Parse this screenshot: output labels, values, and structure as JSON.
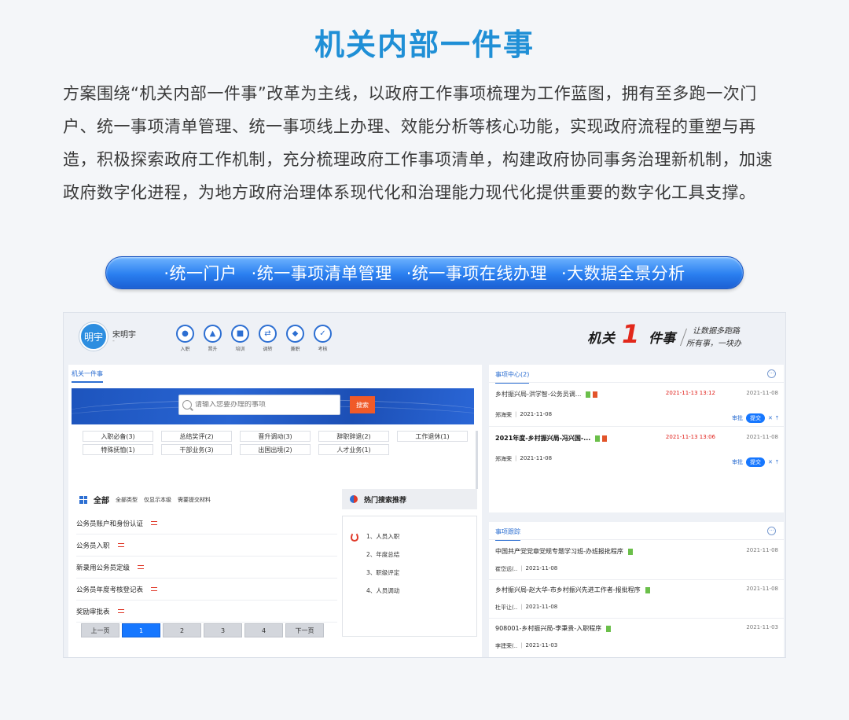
{
  "hero": {
    "title": "机关内部一件事",
    "description": "方案围绕“机关内部一件事”改革为主线，以政府工作事项梳理为工作蓝图，拥有至多跑一次门户、统一事项清单管理、统一事项线上办理、效能分析等核心功能，实现政府流程的重塑与再造，积极探索政府工作机制，充分梳理政府工作事项清单，构建政府协同事务治理新机制，加速政府数字化进程，为地方政府治理体系现代化和治理能力现代化提供重要的数字化工具支撑。",
    "features": [
      "·统一门户",
      "·统一事项清单管理",
      "·统一事项在线办理",
      "·大数据全景分析"
    ]
  },
  "app": {
    "user": {
      "avatar_text": "明宇",
      "name": "宋明宇",
      "sub": "-"
    },
    "quick_actions": [
      {
        "label": "入职",
        "icon": "onboard-icon"
      },
      {
        "label": "晋升",
        "icon": "promotion-icon"
      },
      {
        "label": "培训",
        "icon": "training-icon"
      },
      {
        "label": "调转",
        "icon": "transfer-icon"
      },
      {
        "label": "兼职",
        "icon": "part-time-icon"
      },
      {
        "label": "考核",
        "icon": "assessment-icon"
      }
    ],
    "logo": {
      "part1": "机关",
      "one": "1",
      "part2": "件事",
      "slogan1": "让数据多跑路",
      "slogan2": "所有事，一块办"
    },
    "left": {
      "title": "机关一件事",
      "search_placeholder": "请输入您要办理的事项",
      "search_button": "搜索",
      "categories": [
        "入职必备(3)",
        "总结奖评(2)",
        "晋升调动(3)",
        "辞职辞退(2)",
        "工作退休(1)",
        "特殊抚恤(1)",
        "干部业务(3)",
        "出国出境(2)",
        "人才业务(1)"
      ],
      "filter": {
        "all": "全部",
        "options": [
          "全部类型",
          "仅显示本级",
          "需要提交材料"
        ]
      },
      "items": [
        "公务员账户和身份认证",
        "公务员入职",
        "新录用公务员定级",
        "公务员年度考核登记表",
        "奖励审批表"
      ],
      "pager": [
        "上一页",
        "1",
        "2",
        "3",
        "4",
        "下一页"
      ],
      "pager_active": "1",
      "hot": {
        "title": "热门搜索推荐",
        "items": [
          "1、人员入职",
          "2、年度总结",
          "3、职级评定",
          "4、人员调动"
        ]
      }
    },
    "events": {
      "title": "事项中心(2)",
      "more": "···",
      "items": [
        {
          "title": "乡村振兴局-洪学智-公务员调...",
          "bold": false,
          "time": "2021-11-13 13:12",
          "date": "2021-11-08",
          "person": "郑海荣",
          "person_date": "2021-11-08",
          "approve": "审批",
          "submit": "提交",
          "close": "✕",
          "pin": "⤒"
        },
        {
          "title": "2021年度-乡村振兴局-冯兴国-...",
          "bold": true,
          "time": "2021-11-13 13:06",
          "date": "2021-11-08",
          "person": "郑海荣",
          "person_date": "2021-11-08",
          "approve": "审批",
          "submit": "提交",
          "close": "✕",
          "pin": "⤒"
        }
      ]
    },
    "tracking": {
      "title": "事项跟踪",
      "more": "···",
      "items": [
        {
          "title": "中国共产党党章党规专题学习班-办班报批程序",
          "date": "2021-11-08",
          "person": "崔岱远(..",
          "person_date": "2021-11-08"
        },
        {
          "title": "乡村振兴局-赵大华-市乡村振兴先进工作者-报批程序",
          "date": "2021-11-08",
          "person": "杜平让(..",
          "person_date": "2021-11-08"
        },
        {
          "title": "908001-乡村振兴局-李秉贵-入职程序",
          "date": "2021-11-03",
          "person": "李建荣(..",
          "person_date": "2021-11-03"
        }
      ]
    }
  }
}
